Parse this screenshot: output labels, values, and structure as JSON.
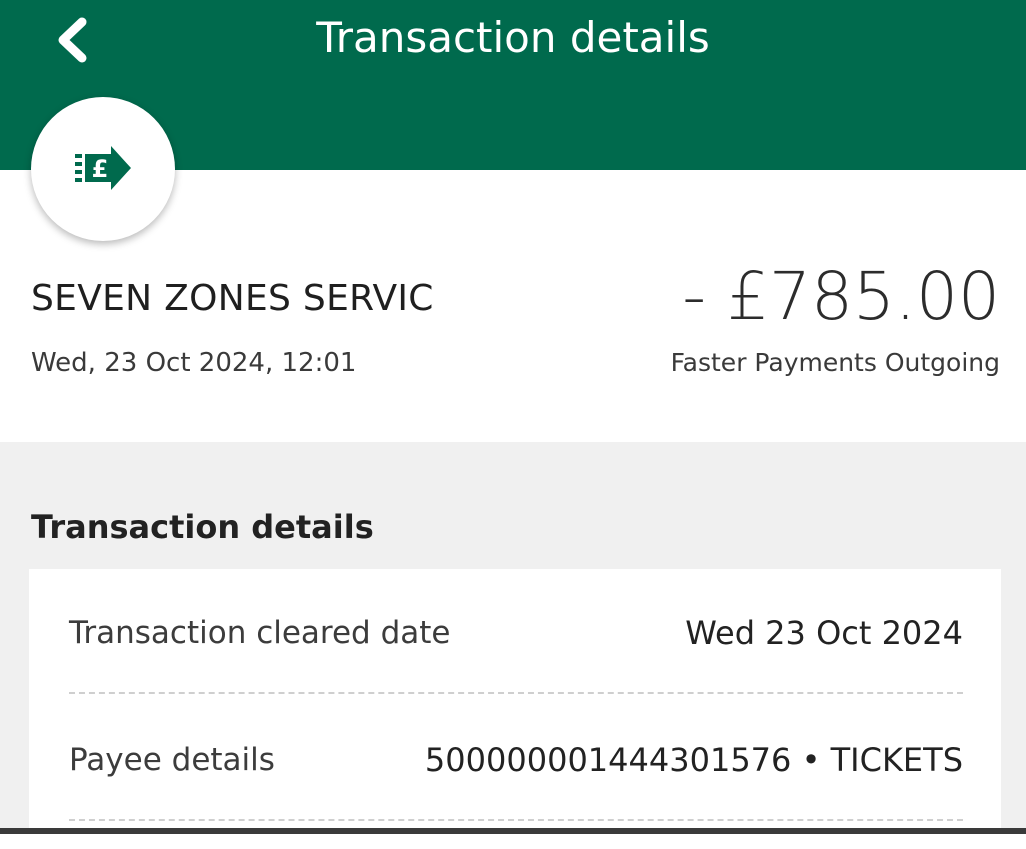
{
  "header": {
    "title": "Transaction details",
    "back_icon": "chevron-left-icon",
    "color": "#006a4d"
  },
  "summary": {
    "icon": "faster-payment-pound-icon",
    "icon_glyph": "£",
    "payee_name": "SEVEN ZONES SERVIC",
    "datetime": "Wed, 23 Oct 2024, 12:01",
    "amount": "- £785.00",
    "payment_type": "Faster Payments Outgoing"
  },
  "details": {
    "heading": "Transaction details",
    "rows": [
      {
        "label": "Transaction cleared date",
        "value": "Wed 23 Oct 2024"
      },
      {
        "label": "Payee details",
        "value": "500000001444301576 • TICKETS"
      }
    ]
  }
}
